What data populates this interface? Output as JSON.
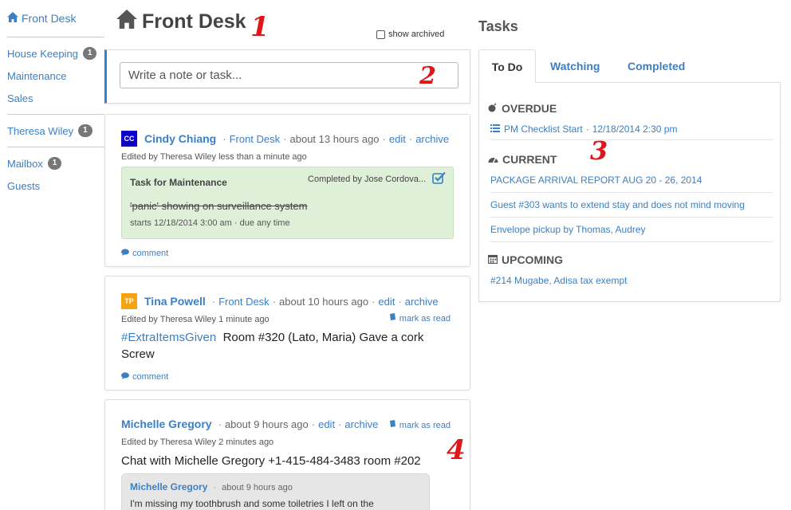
{
  "sidebar": {
    "top": "Front Desk",
    "groups": [
      {
        "label": "House Keeping",
        "badge": "1"
      },
      {
        "label": "Maintenance"
      },
      {
        "label": "Sales"
      }
    ],
    "user": {
      "label": "Theresa Wiley",
      "badge": "1"
    },
    "mailbox": {
      "label": "Mailbox",
      "badge": "1"
    },
    "guests": "Guests"
  },
  "header": {
    "title": "Front Desk",
    "show_archived": "show archived"
  },
  "composer": {
    "placeholder": "Write a note or task..."
  },
  "annotations": [
    "1",
    "2",
    "3",
    "4"
  ],
  "feed": [
    {
      "avatar": "CC",
      "avatar_color": "#0d00c9",
      "author": "Cindy Chiang",
      "channel": "Front Desk",
      "time": "about 13 hours ago",
      "edit": "edit",
      "archive": "archive",
      "edited": "Edited by Theresa Wiley less than a minute ago",
      "task": {
        "title": "Task for Maintenance",
        "completed_by": "Completed by Jose Cordova...",
        "text": "'panic' showing on surveillance system",
        "when": "starts 12/18/2014 3:00 am · due any time"
      },
      "comment": "comment"
    },
    {
      "avatar": "TP",
      "avatar_color": "#f5a30e",
      "author": "Tina Powell",
      "channel": "Front Desk",
      "time": "about 10 hours ago",
      "edit": "edit",
      "archive": "archive",
      "mark_read": "mark as read",
      "edited": "Edited by Theresa Wiley 1 minute ago",
      "hashtag": "#ExtraItemsGiven",
      "body": "Room #320 (Lato, Maria) Gave a cork Screw",
      "comment": "comment"
    },
    {
      "author": "Michelle Gregory",
      "time": "about 9 hours ago",
      "edit": "edit",
      "archive": "archive",
      "mark_read": "mark as read",
      "edited": "Edited by Theresa Wiley 2 minutes ago",
      "body": "Chat with Michelle Gregory +1-415-484-3483 room #202",
      "reply": {
        "author": "Michelle Gregory",
        "time": "about 9 hours ago",
        "text": "I'm missing my toothbrush and some toiletries I left on the"
      }
    }
  ],
  "tasks": {
    "title": "Tasks",
    "tabs": [
      "To Do",
      "Watching",
      "Completed"
    ],
    "overdue": {
      "label": "OVERDUE",
      "items": [
        {
          "title": "PM Checklist Start",
          "date": "12/18/2014 2:30 pm"
        }
      ]
    },
    "current": {
      "label": "CURRENT",
      "items": [
        "PACKAGE ARRIVAL REPORT AUG 20 - 26, 2014",
        "Guest #303 wants to extend stay and does not mind moving",
        "Envelope pickup by Thomas, Audrey"
      ]
    },
    "upcoming": {
      "label": "UPCOMING",
      "items": [
        "#214 Mugabe, Adisa tax exempt"
      ]
    }
  }
}
